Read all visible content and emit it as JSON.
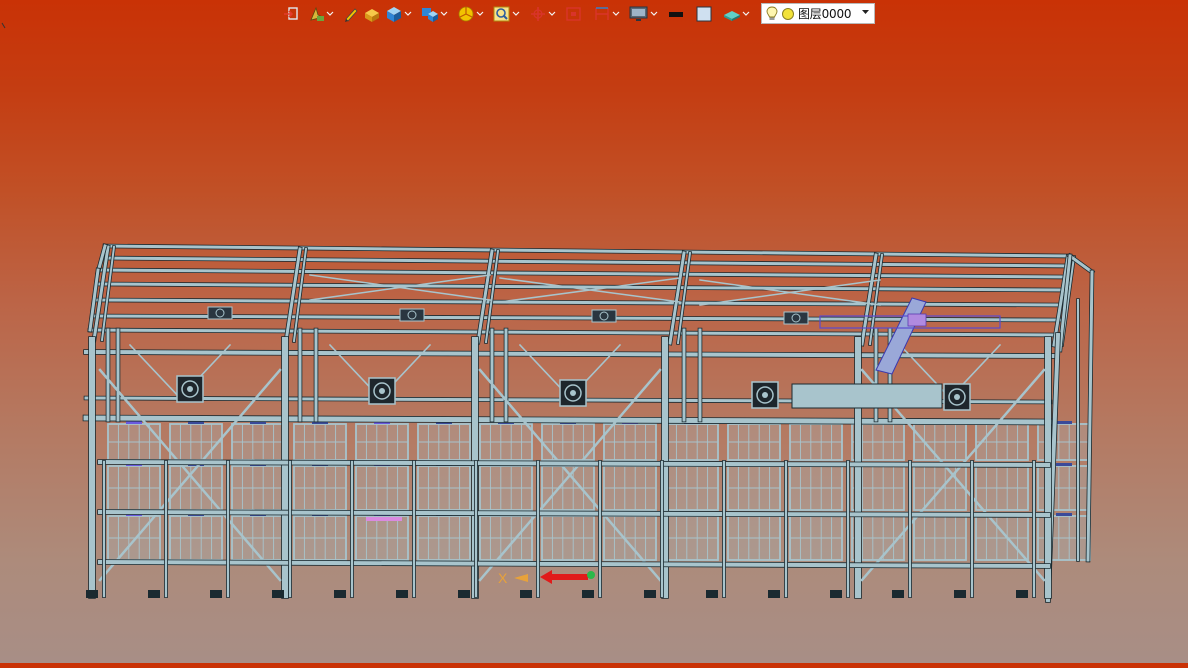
{
  "toolbar": {
    "items": [
      {
        "icon": "sketch-enter-icon",
        "dropdown": false
      },
      {
        "icon": "feature-tool-icon",
        "dropdown": true
      },
      {
        "icon": "pen-icon",
        "dropdown": false
      },
      {
        "icon": "pad-solid-icon",
        "dropdown": false
      },
      {
        "icon": "view-cube-icon",
        "dropdown": true
      },
      {
        "icon": "display-style-icon",
        "dropdown": true
      },
      {
        "icon": "render-mode-icon",
        "dropdown": true
      },
      {
        "icon": "zoom-fit-icon",
        "dropdown": true
      },
      {
        "icon": "rotate-view-icon",
        "dropdown": true
      },
      {
        "icon": "section-view-icon",
        "dropdown": false
      },
      {
        "icon": "measure-icon",
        "dropdown": true
      },
      {
        "icon": "monitor-icon",
        "dropdown": true
      },
      {
        "icon": "line-color-icon",
        "dropdown": false
      },
      {
        "icon": "fill-color-icon",
        "dropdown": false
      },
      {
        "icon": "layer-filter-icon",
        "dropdown": true
      }
    ],
    "colors": {
      "accent_blue": "#2e86d6",
      "accent_yellow": "#f2c200",
      "accent_red": "#d9342b"
    }
  },
  "layer": {
    "current_name": "图层0000",
    "visible_icon": "lightbulb-icon",
    "status_icon": "yellow-dot-icon"
  },
  "viewport": {
    "background_top": "#c93206",
    "background_bottom": "#a88e86",
    "model_color": "#a8c4cc",
    "model_edge_color": "#1a2a30",
    "axis": {
      "x_label": "X",
      "x_color": "#e8a23a",
      "arrow_color": "#e11a1a"
    }
  }
}
